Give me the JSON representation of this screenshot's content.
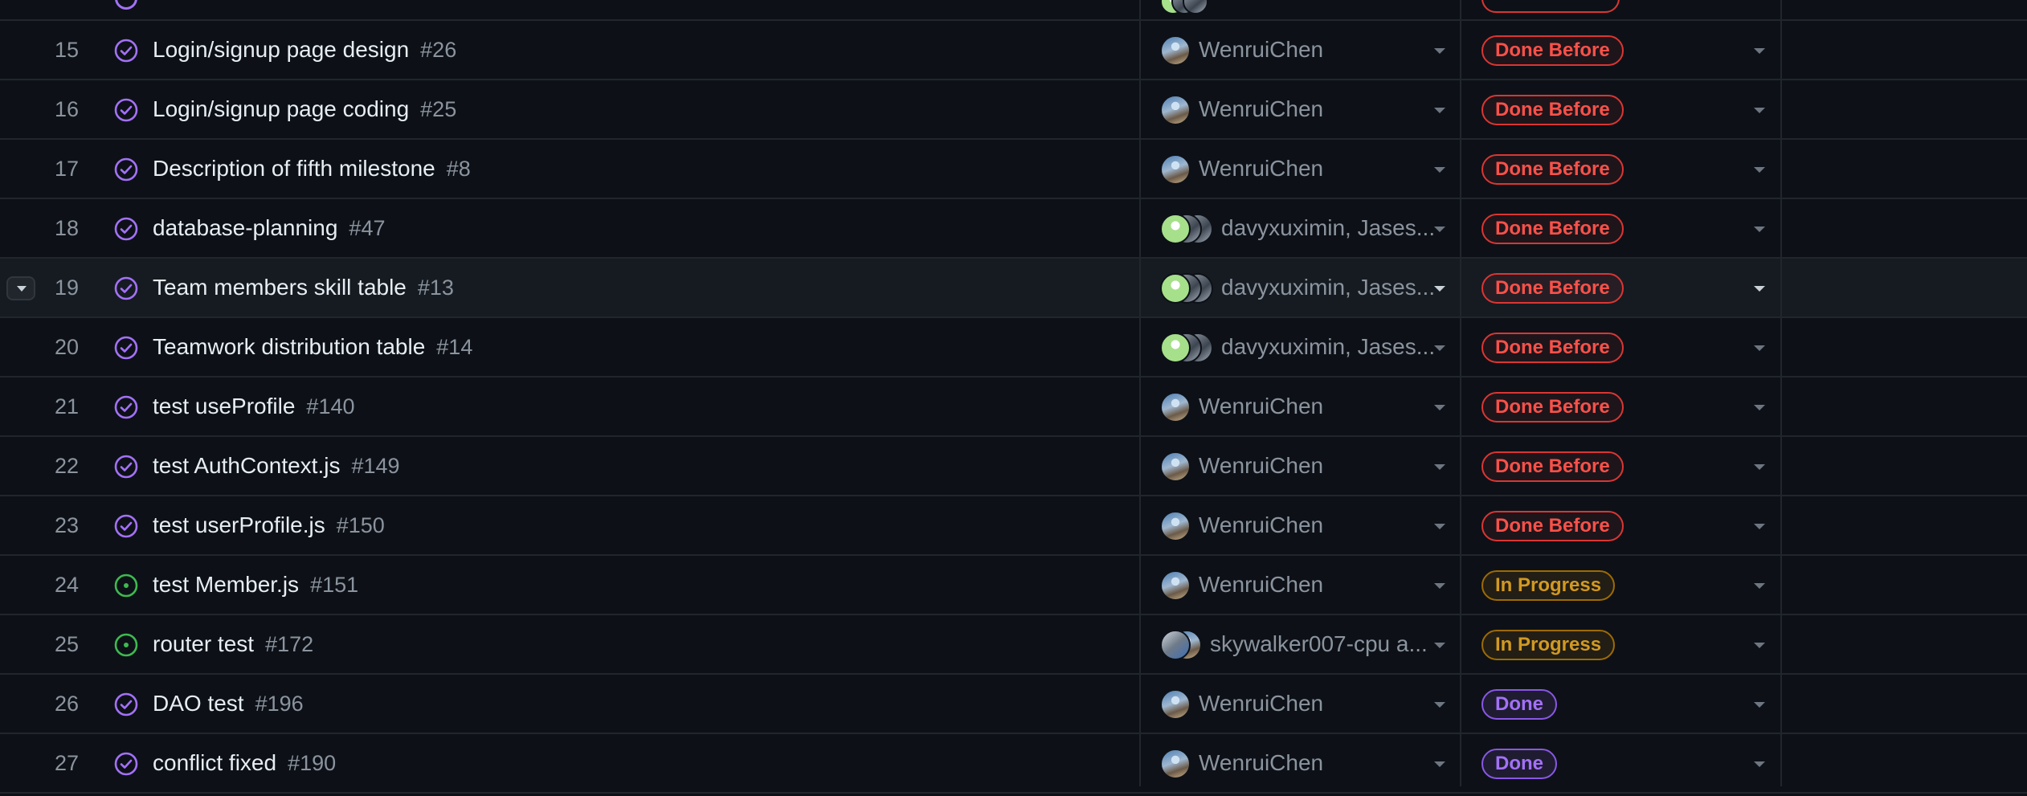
{
  "colors": {
    "background": "#0d1117",
    "done_before": "#f85149",
    "in_progress": "#d29922",
    "done": "#a371f7",
    "closed_icon": "#a371f7",
    "open_icon": "#3fb950"
  },
  "rows": [
    {
      "num": "15",
      "title": "Login/signup page design",
      "issue": "#26",
      "icon": "closed-check-icon",
      "assignee": "WenruiChen",
      "avatars": [
        "wenrui"
      ],
      "status": "Done Before",
      "status_kind": "done-before"
    },
    {
      "num": "16",
      "title": "Login/signup page coding",
      "issue": "#25",
      "icon": "closed-check-icon",
      "assignee": "WenruiChen",
      "avatars": [
        "wenrui"
      ],
      "status": "Done Before",
      "status_kind": "done-before"
    },
    {
      "num": "17",
      "title": "Description of fifth milestone",
      "issue": "#8",
      "icon": "closed-check-icon",
      "assignee": "WenruiChen",
      "avatars": [
        "wenrui"
      ],
      "status": "Done Before",
      "status_kind": "done-before"
    },
    {
      "num": "18",
      "title": "database-planning",
      "issue": "#47",
      "icon": "closed-check-icon",
      "assignee": "davyxuximin, Jases...",
      "avatars": [
        "davy",
        "grey",
        "grey"
      ],
      "status": "Done Before",
      "status_kind": "done-before"
    },
    {
      "num": "19",
      "title": "Team members skill table",
      "issue": "#13",
      "icon": "closed-check-icon",
      "assignee": "davyxuximin, Jases...",
      "avatars": [
        "davy",
        "grey",
        "grey"
      ],
      "status": "Done Before",
      "status_kind": "done-before",
      "selected": true
    },
    {
      "num": "20",
      "title": "Teamwork distribution table",
      "issue": "#14",
      "icon": "closed-check-icon",
      "assignee": "davyxuximin, Jases...",
      "avatars": [
        "davy",
        "grey",
        "grey"
      ],
      "status": "Done Before",
      "status_kind": "done-before"
    },
    {
      "num": "21",
      "title": "test useProfile",
      "issue": "#140",
      "icon": "closed-check-icon",
      "assignee": "WenruiChen",
      "avatars": [
        "wenrui"
      ],
      "status": "Done Before",
      "status_kind": "done-before"
    },
    {
      "num": "22",
      "title": "test AuthContext.js",
      "issue": "#149",
      "icon": "closed-check-icon",
      "assignee": "WenruiChen",
      "avatars": [
        "wenrui"
      ],
      "status": "Done Before",
      "status_kind": "done-before"
    },
    {
      "num": "23",
      "title": "test userProfile.js",
      "issue": "#150",
      "icon": "closed-check-icon",
      "assignee": "WenruiChen",
      "avatars": [
        "wenrui"
      ],
      "status": "Done Before",
      "status_kind": "done-before"
    },
    {
      "num": "24",
      "title": "test Member.js",
      "issue": "#151",
      "icon": "open-issue-icon",
      "assignee": "WenruiChen",
      "avatars": [
        "wenrui"
      ],
      "status": "In Progress",
      "status_kind": "in-progress"
    },
    {
      "num": "25",
      "title": "router test",
      "issue": "#172",
      "icon": "open-issue-icon",
      "assignee": "skywalker007-cpu a...",
      "avatars": [
        "sky",
        "wenrui"
      ],
      "status": "In Progress",
      "status_kind": "in-progress"
    },
    {
      "num": "26",
      "title": "DAO test",
      "issue": "#196",
      "icon": "closed-check-icon",
      "assignee": "WenruiChen",
      "avatars": [
        "wenrui"
      ],
      "status": "Done",
      "status_kind": "done"
    },
    {
      "num": "27",
      "title": "conflict fixed",
      "issue": "#190",
      "icon": "closed-check-icon",
      "assignee": "WenruiChen",
      "avatars": [
        "wenrui"
      ],
      "status": "Done",
      "status_kind": "done"
    }
  ]
}
